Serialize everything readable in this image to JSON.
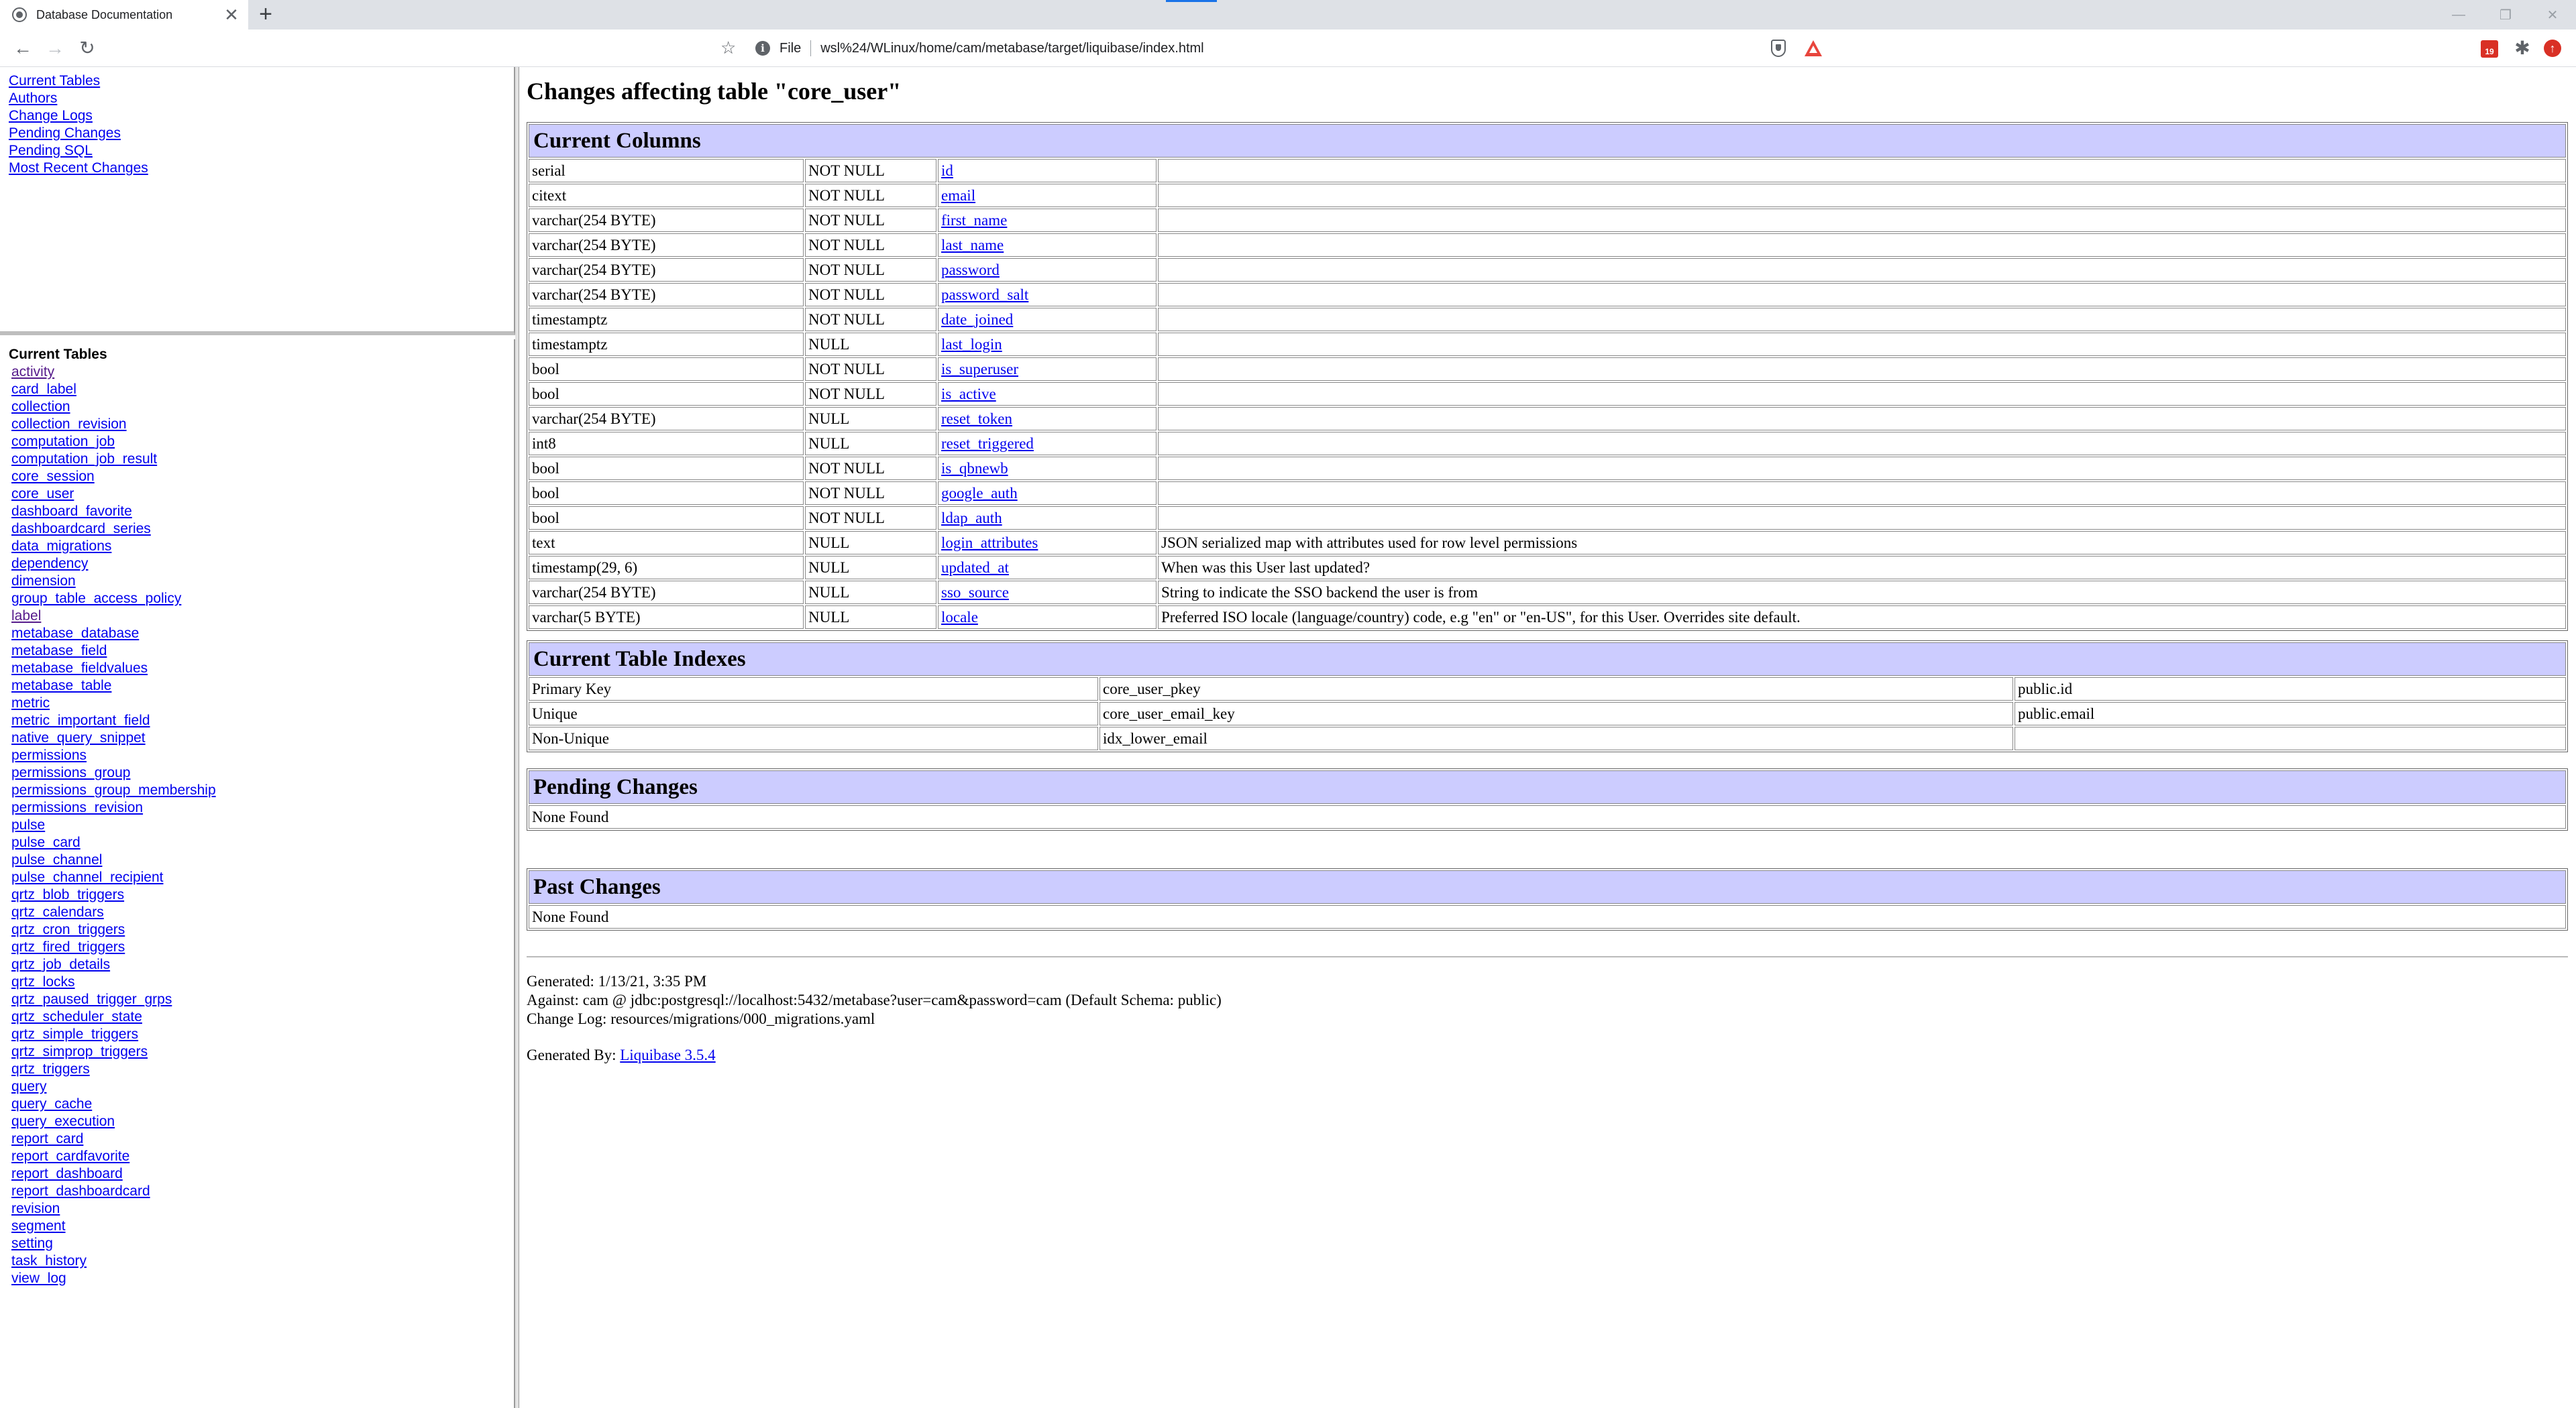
{
  "browser": {
    "tab_title": "Database Documentation",
    "tab_close": "✕",
    "new_tab": "+",
    "address_scheme": "File",
    "address_url": "wsl%24/WLinux/home/cam/metabase/target/liquibase/index.html",
    "extension_badge": "19",
    "window_controls": {
      "minimize": "—",
      "restore": "❐",
      "close": "✕"
    },
    "nav": {
      "back": "←",
      "forward": "→",
      "reload": "↻",
      "bookmark": "🔖"
    }
  },
  "nav_frame": {
    "links": [
      "Current Tables",
      "Authors",
      "Change Logs",
      "Pending Changes",
      "Pending SQL",
      "Most Recent Changes"
    ]
  },
  "tables_frame": {
    "heading": "Current Tables",
    "tables": [
      "activity",
      "card_label",
      "collection",
      "collection_revision",
      "computation_job",
      "computation_job_result",
      "core_session",
      "core_user",
      "dashboard_favorite",
      "dashboardcard_series",
      "data_migrations",
      "dependency",
      "dimension",
      "group_table_access_policy",
      "label",
      "metabase_database",
      "metabase_field",
      "metabase_fieldvalues",
      "metabase_table",
      "metric",
      "metric_important_field",
      "native_query_snippet",
      "permissions",
      "permissions_group",
      "permissions_group_membership",
      "permissions_revision",
      "pulse",
      "pulse_card",
      "pulse_channel",
      "pulse_channel_recipient",
      "qrtz_blob_triggers",
      "qrtz_calendars",
      "qrtz_cron_triggers",
      "qrtz_fired_triggers",
      "qrtz_job_details",
      "qrtz_locks",
      "qrtz_paused_trigger_grps",
      "qrtz_scheduler_state",
      "qrtz_simple_triggers",
      "qrtz_simprop_triggers",
      "qrtz_triggers",
      "query",
      "query_cache",
      "query_execution",
      "report_card",
      "report_cardfavorite",
      "report_dashboard",
      "report_dashboardcard",
      "revision",
      "segment",
      "setting",
      "task_history",
      "view_log"
    ],
    "visited": [
      "activity",
      "label"
    ]
  },
  "main": {
    "title": "Changes affecting table \"core_user\"",
    "columns_heading": "Current Columns",
    "columns": [
      {
        "type": "serial",
        "nullable": "NOT NULL",
        "name": "id",
        "remarks": ""
      },
      {
        "type": "citext",
        "nullable": "NOT NULL",
        "name": "email",
        "remarks": ""
      },
      {
        "type": "varchar(254 BYTE)",
        "nullable": "NOT NULL",
        "name": "first_name",
        "remarks": ""
      },
      {
        "type": "varchar(254 BYTE)",
        "nullable": "NOT NULL",
        "name": "last_name",
        "remarks": ""
      },
      {
        "type": "varchar(254 BYTE)",
        "nullable": "NOT NULL",
        "name": "password",
        "remarks": ""
      },
      {
        "type": "varchar(254 BYTE)",
        "nullable": "NOT NULL",
        "name": "password_salt",
        "remarks": ""
      },
      {
        "type": "timestamptz",
        "nullable": "NOT NULL",
        "name": "date_joined",
        "remarks": ""
      },
      {
        "type": "timestamptz",
        "nullable": "NULL",
        "name": "last_login",
        "remarks": ""
      },
      {
        "type": "bool",
        "nullable": "NOT NULL",
        "name": "is_superuser",
        "remarks": ""
      },
      {
        "type": "bool",
        "nullable": "NOT NULL",
        "name": "is_active",
        "remarks": ""
      },
      {
        "type": "varchar(254 BYTE)",
        "nullable": "NULL",
        "name": "reset_token",
        "remarks": ""
      },
      {
        "type": "int8",
        "nullable": "NULL",
        "name": "reset_triggered",
        "remarks": ""
      },
      {
        "type": "bool",
        "nullable": "NOT NULL",
        "name": "is_qbnewb",
        "remarks": ""
      },
      {
        "type": "bool",
        "nullable": "NOT NULL",
        "name": "google_auth",
        "remarks": ""
      },
      {
        "type": "bool",
        "nullable": "NOT NULL",
        "name": "ldap_auth",
        "remarks": ""
      },
      {
        "type": "text",
        "nullable": "NULL",
        "name": "login_attributes",
        "remarks": "JSON serialized map with attributes used for row level permissions"
      },
      {
        "type": "timestamp(29, 6)",
        "nullable": "NULL",
        "name": "updated_at",
        "remarks": "When was this User last updated?"
      },
      {
        "type": "varchar(254 BYTE)",
        "nullable": "NULL",
        "name": "sso_source",
        "remarks": "String to indicate the SSO backend the user is from"
      },
      {
        "type": "varchar(5 BYTE)",
        "nullable": "NULL",
        "name": "locale",
        "remarks": "Preferred ISO locale (language/country) code, e.g \"en\" or \"en-US\", for this User. Overrides site default."
      }
    ],
    "indexes_heading": "Current Table Indexes",
    "indexes": [
      {
        "kind": "Primary Key",
        "name": "core_user_pkey",
        "columns": "public.id"
      },
      {
        "kind": "Unique",
        "name": "core_user_email_key",
        "columns": "public.email"
      },
      {
        "kind": "Non-Unique",
        "name": "idx_lower_email",
        "columns": ""
      }
    ],
    "pending_heading": "Pending Changes",
    "pending_value": "None Found",
    "past_heading": "Past Changes",
    "past_value": "None Found",
    "footer": {
      "generated": "Generated: 1/13/21, 3:35 PM",
      "against": "Against: cam @ jdbc:postgresql://localhost:5432/metabase?user=cam&password=cam (Default Schema: public)",
      "changelog": "Change Log: resources/migrations/000_migrations.yaml",
      "generated_by_prefix": "Generated By: ",
      "generated_by_link": "Liquibase 3.5.4"
    }
  }
}
